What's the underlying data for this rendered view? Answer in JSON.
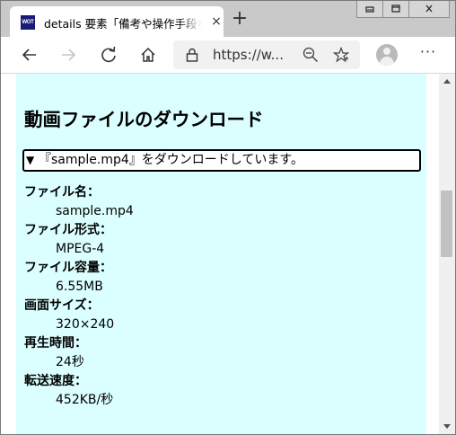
{
  "browser": {
    "tab": {
      "favicon_text": "WOT",
      "title": "details 要素「備考や操作手段など",
      "close_glyph": "×"
    },
    "new_tab_glyph": "+",
    "address": {
      "url_display": "https://w..."
    },
    "more_glyph": "···",
    "icons": [
      "back-icon",
      "forward-icon",
      "refresh-icon",
      "home-icon",
      "lock-icon",
      "zoom-out-icon",
      "favorite-star-icon",
      "profile-icon",
      "more-icon",
      "minimize-icon",
      "maximize-icon",
      "close-icon"
    ]
  },
  "page": {
    "heading": "動画ファイルのダウンロード",
    "details": {
      "marker": "▼",
      "summary": "『sample.mp4』をダウンロードしています。",
      "expanded": true
    },
    "info": [
      {
        "term": "ファイル名：",
        "value": "sample.mp4"
      },
      {
        "term": "ファイル形式：",
        "value": "MPEG-4"
      },
      {
        "term": "ファイル容量：",
        "value": "6.55MB"
      },
      {
        "term": "画面サイズ：",
        "value": "320×240"
      },
      {
        "term": "再生時間：",
        "value": "24秒"
      },
      {
        "term": "転送速度：",
        "value": "452KB/秒"
      }
    ],
    "background_color": "#dbffff"
  }
}
